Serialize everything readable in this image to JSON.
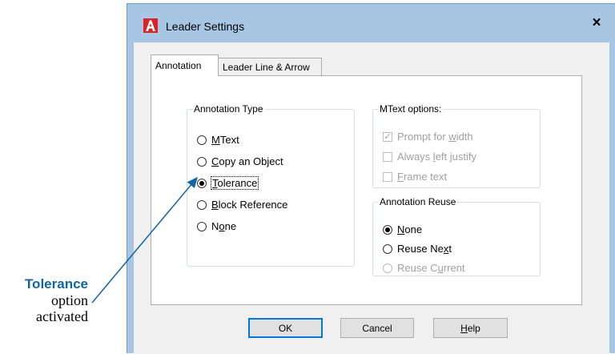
{
  "window": {
    "title": "Leader Settings",
    "close_label": "×"
  },
  "tabs": [
    {
      "label": "Annotation",
      "active": true
    },
    {
      "label": "Leader Line & Arrow",
      "active": false
    }
  ],
  "annotation_type": {
    "legend": "Annotation Type",
    "options": [
      {
        "label": "MText",
        "checked": false
      },
      {
        "label": "Copy an Object",
        "checked": false
      },
      {
        "label": "Tolerance",
        "checked": true
      },
      {
        "label": "Block Reference",
        "checked": false
      },
      {
        "label": "None",
        "checked": false
      }
    ]
  },
  "mtext_options": {
    "legend": "MText options:",
    "options": [
      {
        "label": "Prompt for width",
        "checked": true,
        "enabled": false
      },
      {
        "label": "Always left justify",
        "checked": false,
        "enabled": false
      },
      {
        "label": "Frame text",
        "checked": false,
        "enabled": false
      }
    ]
  },
  "annotation_reuse": {
    "legend": "Annotation Reuse",
    "options": [
      {
        "label": "None",
        "checked": true,
        "enabled": true
      },
      {
        "label": "Reuse Next",
        "checked": false,
        "enabled": true
      },
      {
        "label": "Reuse Current",
        "checked": false,
        "enabled": false
      }
    ]
  },
  "buttons": {
    "ok": "OK",
    "cancel": "Cancel",
    "help": "Help"
  },
  "callout": {
    "bold": "Tolerance",
    "line2": "option",
    "line3": "activated",
    "color": "#1264a3"
  }
}
